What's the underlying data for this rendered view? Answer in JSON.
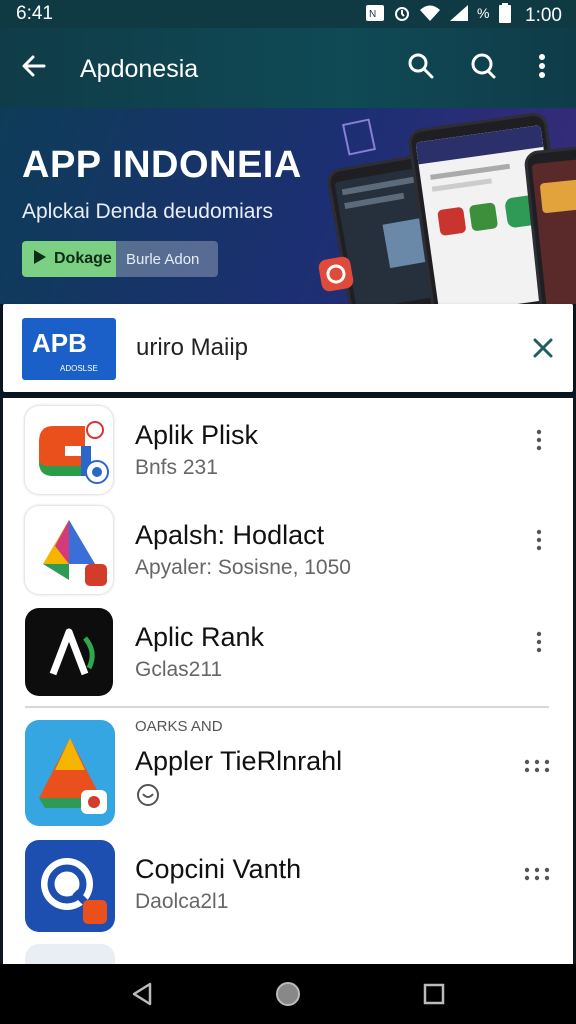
{
  "status": {
    "time": "6:41",
    "clock": "1:00"
  },
  "appbar": {
    "title": "Apdonesia"
  },
  "banner": {
    "title": "APP INDONEIA",
    "subtitle": "Aplckai Denda deudomiars",
    "chip_primary": "Dokage",
    "chip_secondary": "Burle Adon"
  },
  "search": {
    "logo_text": "APB",
    "logo_small": "ADOSLSE",
    "query": "uriro Maiip"
  },
  "list": {
    "section_label": "OARKS AND",
    "items": [
      {
        "name": "Aplik Plisk",
        "sub": "Bnfs 231"
      },
      {
        "name": "Apalsh: Hodlact",
        "sub": "Apyaler: Sosisne, 1050"
      },
      {
        "name": "Aplic Rank",
        "sub": "Gclas211"
      },
      {
        "name": "Appler TieRlnrahl",
        "sub": ""
      },
      {
        "name": "Copcini Vanth",
        "sub": "Daolca2l1"
      }
    ]
  },
  "colors": {
    "appbar": "#0f4a55",
    "accent": "#1b5fc8",
    "close": "#1f5f63"
  }
}
